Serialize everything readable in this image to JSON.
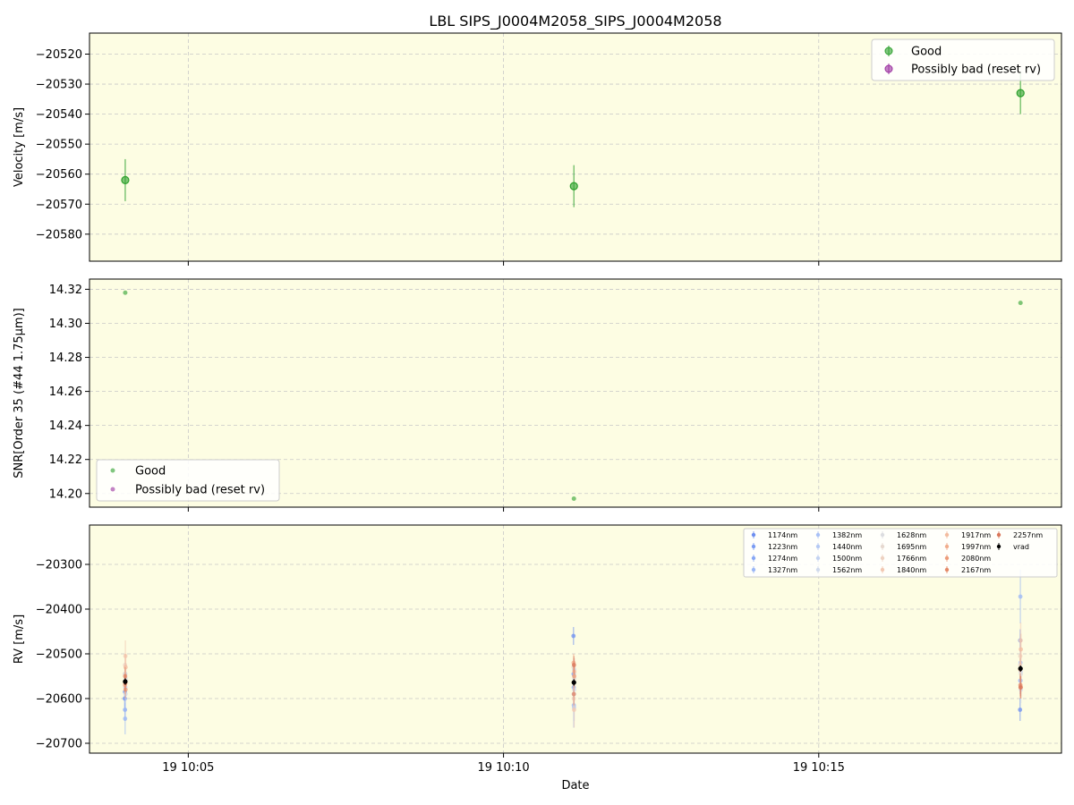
{
  "chart_data": [
    {
      "type": "scatter",
      "title": "LBL SIPS_J0004M2058_SIPS_J0004M2058",
      "ylabel": "Velocity [m/s]",
      "xlabel": "",
      "x_ticks": [
        "19 10:05",
        "19 10:10",
        "19 10:15"
      ],
      "y_ticks": [
        -20520,
        -20530,
        -20540,
        -20550,
        -20560,
        -20570,
        -20580
      ],
      "ylim": [
        -20589,
        -20513
      ],
      "grid": true,
      "legend_position": "upper right",
      "series": [
        {
          "name": "Good",
          "color": "#2ca02c",
          "x": [
            "19 10:04:00",
            "19 10:11:07",
            "19 10:18:12"
          ],
          "y": [
            -20562,
            -20564,
            -20533
          ],
          "yerr": [
            7,
            7,
            7
          ]
        },
        {
          "name": "Possibly bad (reset rv)",
          "color": "#9b30a0",
          "x": [],
          "y": [],
          "yerr": []
        }
      ]
    },
    {
      "type": "scatter",
      "title": "",
      "ylabel": "SNR[Order 35 (#44 1.75μm)]",
      "xlabel": "",
      "x_ticks": [
        "19 10:05",
        "19 10:10",
        "19 10:15"
      ],
      "y_ticks": [
        "14.32",
        "14.30",
        "14.28",
        "14.26",
        "14.24",
        "14.22",
        "14.20"
      ],
      "ylim": [
        14.192,
        14.326
      ],
      "grid": true,
      "legend_position": "lower left",
      "series": [
        {
          "name": "Good",
          "color": "#2ca02c",
          "x": [
            "19 10:04:00",
            "19 10:11:07",
            "19 10:18:12"
          ],
          "y": [
            14.318,
            14.197,
            14.312
          ]
        },
        {
          "name": "Possibly bad (reset rv)",
          "color": "#9b30a0",
          "x": [],
          "y": []
        }
      ]
    },
    {
      "type": "scatter",
      "title": "",
      "ylabel": "RV [m/s]",
      "xlabel": "Date",
      "x_ticks": [
        "19 10:05",
        "19 10:10",
        "19 10:15"
      ],
      "y_ticks": [
        -20300,
        -20400,
        -20500,
        -20600,
        -20700
      ],
      "ylim": [
        -20722,
        -20212
      ],
      "grid": true,
      "legend_position": "upper right",
      "legend_columns": 5,
      "series": [
        {
          "name": "1174nm",
          "color": "#6e8ff0",
          "y": [
            -20600,
            -20460,
            -20625
          ],
          "yerr": [
            20,
            20,
            25
          ]
        },
        {
          "name": "1223nm",
          "color": "#7b9cf3",
          "y": [
            -20585,
            -20545,
            -20470
          ],
          "yerr": [
            20,
            20,
            25
          ]
        },
        {
          "name": "1274nm",
          "color": "#88a8f5",
          "y": [
            -20625,
            -20575,
            -20560
          ],
          "yerr": [
            25,
            25,
            30
          ]
        },
        {
          "name": "1327nm",
          "color": "#9bb7f6",
          "y": [
            -20645,
            -20615,
            -20372
          ],
          "yerr": [
            35,
            50,
            60
          ]
        },
        {
          "name": "1382nm",
          "color": "#a9c1f6",
          "y": [
            -20545,
            -20590,
            -20520
          ],
          "yerr": [
            25,
            30,
            40
          ]
        },
        {
          "name": "1440nm",
          "color": "#b5c9f4",
          "y": [
            -20575,
            -20620,
            -20560
          ],
          "yerr": [
            25,
            30,
            35
          ]
        },
        {
          "name": "1500nm",
          "color": "#c4d3f1",
          "y": [
            -20560,
            -20535,
            -20540
          ],
          "yerr": [
            20,
            25,
            30
          ]
        },
        {
          "name": "1562nm",
          "color": "#d0daec",
          "y": [
            -20590,
            -20580,
            -20580
          ],
          "yerr": [
            20,
            25,
            30
          ]
        },
        {
          "name": "1628nm",
          "color": "#dcdde0",
          "y": [
            -20555,
            -20555,
            -20545
          ],
          "yerr": [
            20,
            20,
            25
          ]
        },
        {
          "name": "1695nm",
          "color": "#e6d9d0",
          "y": [
            -20545,
            -20530,
            -20525
          ],
          "yerr": [
            20,
            20,
            25
          ]
        },
        {
          "name": "1766nm",
          "color": "#eed2c1",
          "y": [
            -20525,
            -20600,
            -20505
          ],
          "yerr": [
            25,
            30,
            30
          ]
        },
        {
          "name": "1840nm",
          "color": "#f2c8b2",
          "y": [
            -20505,
            -20625,
            -20470
          ],
          "yerr": [
            35,
            40,
            40
          ]
        },
        {
          "name": "1917nm",
          "color": "#f3bca0",
          "y": [
            -20530,
            -20540,
            -20490
          ],
          "yerr": [
            30,
            30,
            35
          ]
        },
        {
          "name": "1997nm",
          "color": "#f1ad8d",
          "y": [
            -20570,
            -20520,
            -20535
          ],
          "yerr": [
            20,
            20,
            25
          ]
        },
        {
          "name": "2080nm",
          "color": "#ec9c7a",
          "y": [
            -20580,
            -20550,
            -20575
          ],
          "yerr": [
            20,
            25,
            25
          ]
        },
        {
          "name": "2167nm",
          "color": "#e48a69",
          "y": [
            -20550,
            -20590,
            -20570
          ],
          "yerr": [
            20,
            25,
            25
          ]
        },
        {
          "name": "2257nm",
          "color": "#d9765a",
          "y": [
            -20565,
            -20525,
            -20575
          ],
          "yerr": [
            20,
            20,
            25
          ]
        },
        {
          "name": "vrad",
          "color": "#000000",
          "y": [
            -20562,
            -20564,
            -20533
          ],
          "yerr": [
            7,
            7,
            7
          ]
        }
      ],
      "x": [
        "19 10:04:00",
        "19 10:11:07",
        "19 10:18:12"
      ]
    }
  ]
}
